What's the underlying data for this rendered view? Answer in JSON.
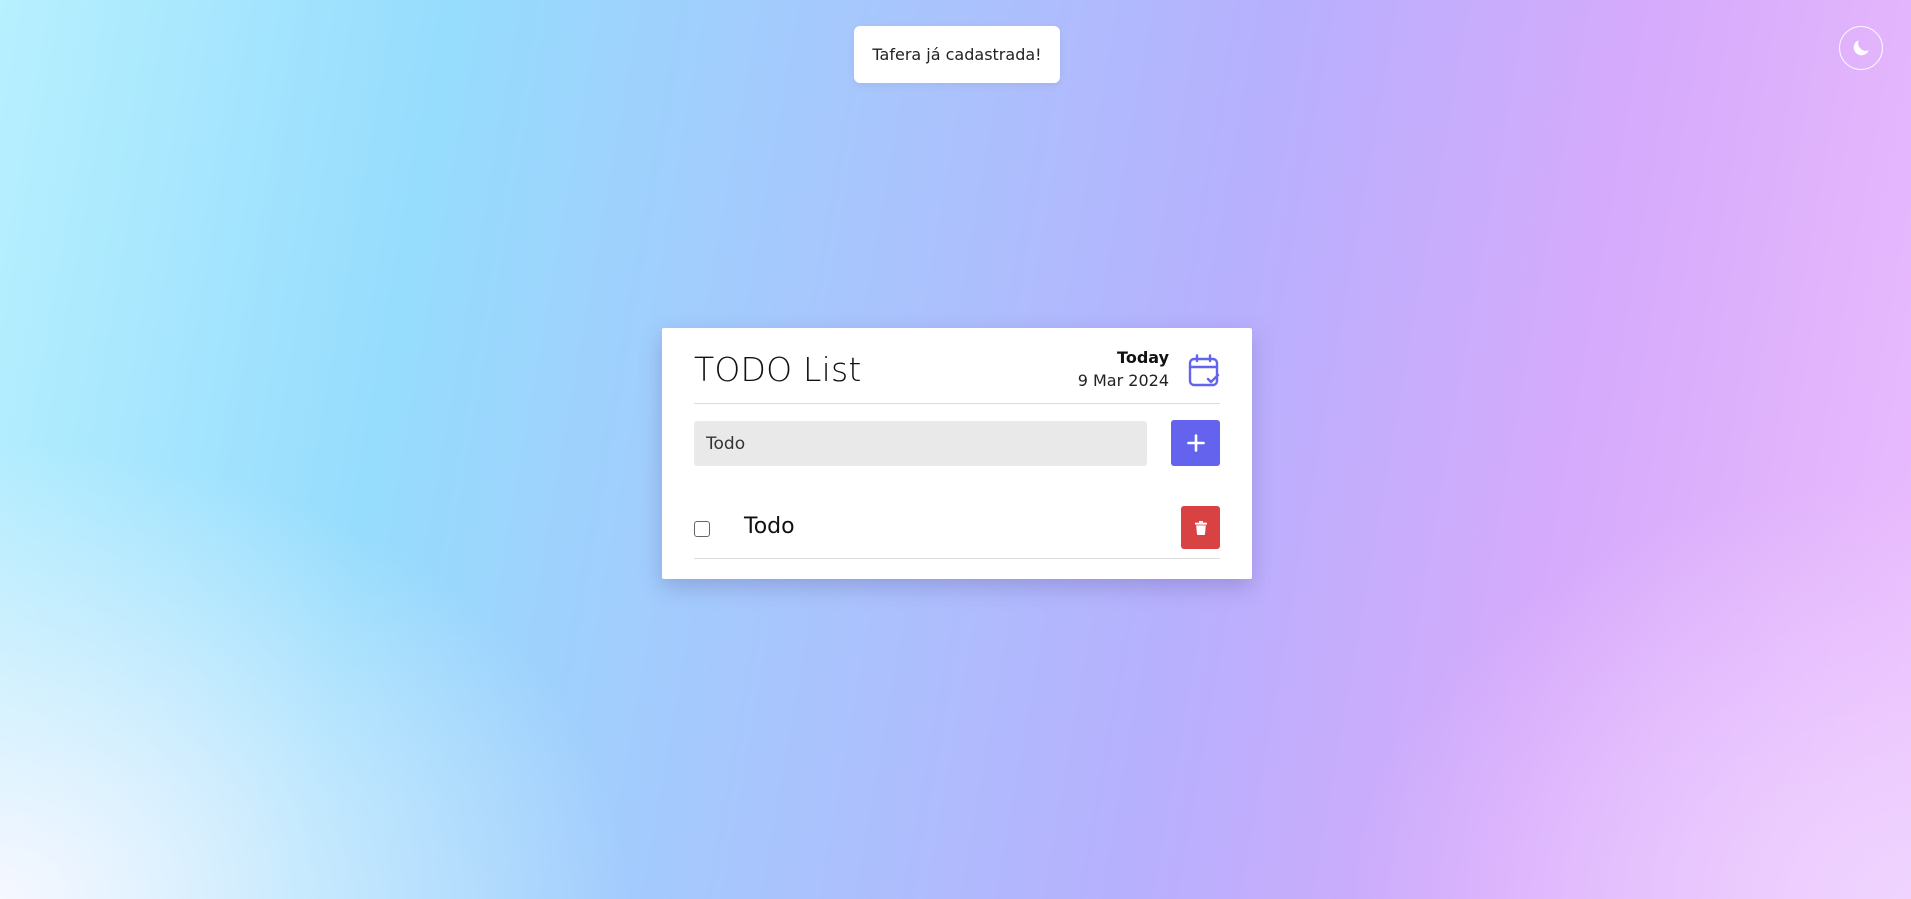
{
  "toast": {
    "message": "Tafera já cadastrada!"
  },
  "theme_toggle": {
    "icon": "moon-icon"
  },
  "card": {
    "title": "TODO List",
    "date_label": "Today",
    "date_value": "9 Mar 2024",
    "calendar_icon": "calendar-check-icon"
  },
  "form": {
    "input_value": "Todo",
    "input_placeholder": "",
    "add_icon": "plus-icon"
  },
  "todos": [
    {
      "text": "Todo",
      "done": false,
      "delete_icon": "trash-icon"
    }
  ],
  "colors": {
    "accent": "#6363ed",
    "danger": "#d94242",
    "input_bg": "#e9e9e9"
  }
}
